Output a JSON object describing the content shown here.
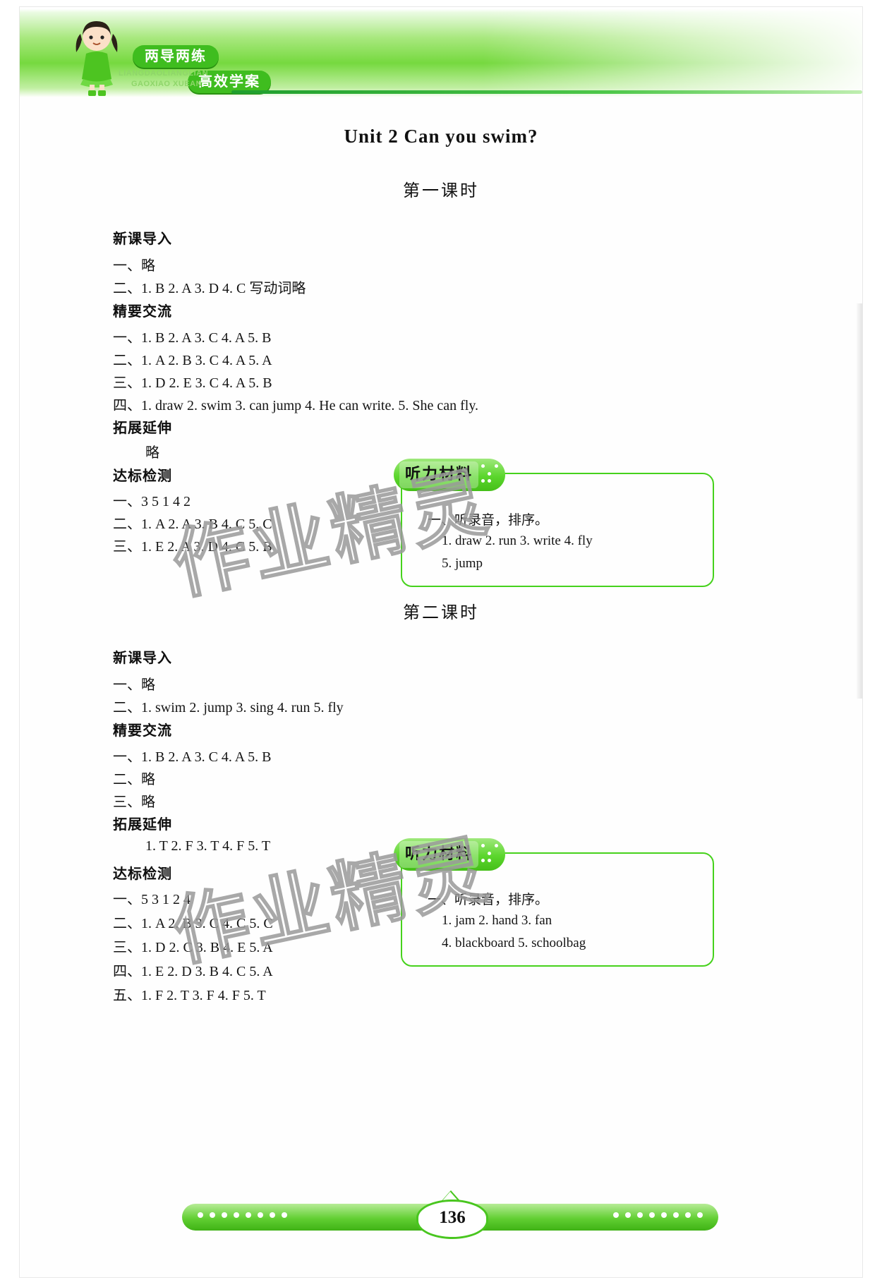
{
  "header": {
    "brand_cn_1": "两导两练",
    "brand_cn_2": "高效学案",
    "brand_pinyin_1": "LIANGDAOLIANGLIAN",
    "brand_pinyin_2": "GAOXIAO XUEAN",
    "accent_color": "#46d21c"
  },
  "unit_title": "Unit 2  Can  you  swim?",
  "lessons": [
    {
      "title": "第一课时",
      "sections": [
        {
          "heading": "新课导入",
          "lines": [
            "一、略",
            "二、1. B  2. A  3. D  4. C   写动词略"
          ]
        },
        {
          "heading": "精要交流",
          "lines": [
            "一、1. B  2. A  3. C  4. A  5. B",
            "二、1. A  2. B  3. C  4. A  5. A",
            "三、1. D  2. E  3. C  4. A  5. B",
            "四、1. draw   2. swim   3. can jump   4. He can write.    5. She can fly."
          ]
        },
        {
          "heading": "拓展延伸",
          "lines": [
            "略"
          ]
        },
        {
          "heading": "达标检测",
          "lines": [
            "一、3  5   1   4  2",
            "二、1. A   2. A   3. B   4. C   5. C",
            "三、1. E   2. A   3. D   4. C   5. B"
          ]
        }
      ],
      "listening": {
        "tab_label": "听力材料",
        "lines": [
          "一、听录音，排序。",
          "1. draw    2. run    3. write    4. fly",
          "5. jump"
        ]
      }
    },
    {
      "title": "第二课时",
      "sections": [
        {
          "heading": "新课导入",
          "lines": [
            "一、略",
            "二、1. swim   2. jump   3. sing   4. run   5. fly"
          ]
        },
        {
          "heading": "精要交流",
          "lines": [
            "一、1. B  2. A  3. C  4. A  5. B",
            "二、略",
            "三、略"
          ]
        },
        {
          "heading": "拓展延伸",
          "lines": [
            "1. T  2. F  3. T  4. F  5. T"
          ]
        },
        {
          "heading": "达标检测",
          "lines": [
            "一、5  3  1  2  4",
            "二、1. A   2. B   3. C   4. C   5. C",
            "三、1. D   2. C   3. B   4. E   5. A",
            "四、1. E   2. D   3. B   4. C   5. A",
            "五、1. F   2. T   3. F   4. F   5. T"
          ]
        }
      ],
      "listening": {
        "tab_label": "听力材料",
        "lines": [
          "一、听录音，排序。",
          "1. jam    2. hand    3. fan",
          "4. blackboard    5. schoolbag"
        ]
      }
    }
  ],
  "watermark": "作业精灵",
  "page_number": "136"
}
